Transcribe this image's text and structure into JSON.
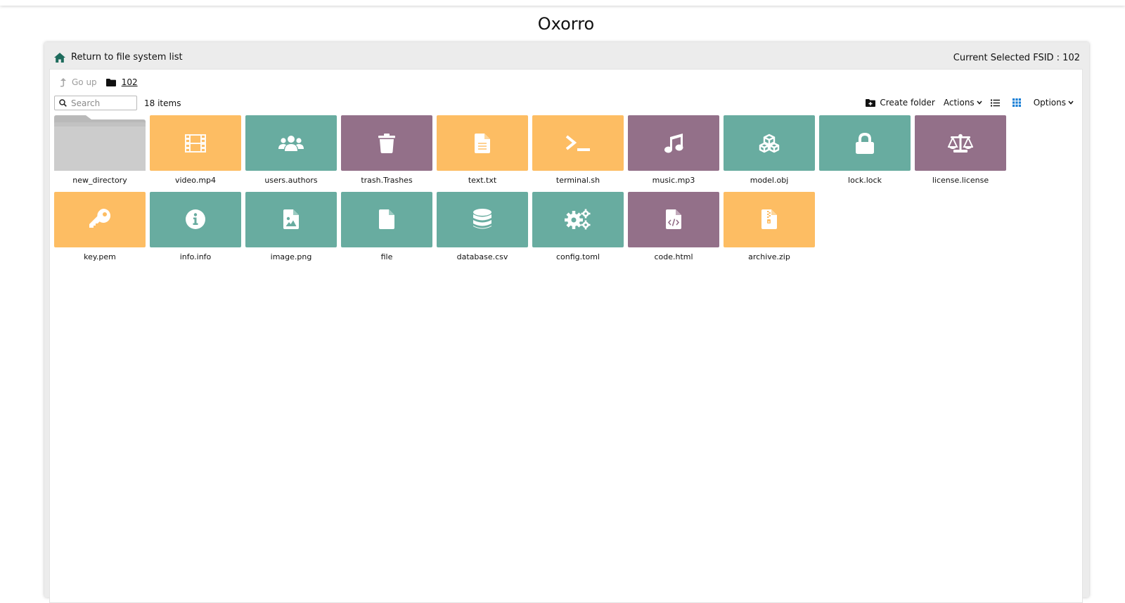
{
  "app": {
    "title": "Oxorro"
  },
  "header": {
    "return_label": "Return to file system list",
    "fsid_label": "Current Selected FSID : 102"
  },
  "breadcrumb": {
    "go_up_label": "Go up",
    "current_folder": "102"
  },
  "search": {
    "placeholder": "Search",
    "value": ""
  },
  "item_count": "18 items",
  "toolbar": {
    "create_folder_label": "Create folder",
    "actions_label": "Actions",
    "options_label": "Options",
    "active_view": "grid"
  },
  "colors": {
    "orange": "#fdbd63",
    "teal": "#68aca0",
    "purple": "#937089",
    "folder": "#cccccc",
    "home_icon": "#1d6b5c",
    "active_view_icon": "#1a7fd6"
  },
  "files": [
    {
      "name": "new_directory",
      "type": "folder",
      "color": "folder",
      "icon": "folder-icon"
    },
    {
      "name": "video.mp4",
      "type": "file",
      "color": "orange",
      "icon": "film-icon"
    },
    {
      "name": "users.authors",
      "type": "file",
      "color": "teal",
      "icon": "users-icon"
    },
    {
      "name": "trash.Trashes",
      "type": "file",
      "color": "purple",
      "icon": "trash-icon"
    },
    {
      "name": "text.txt",
      "type": "file",
      "color": "orange",
      "icon": "text-file-icon"
    },
    {
      "name": "terminal.sh",
      "type": "file",
      "color": "orange",
      "icon": "terminal-icon"
    },
    {
      "name": "music.mp3",
      "type": "file",
      "color": "purple",
      "icon": "music-icon"
    },
    {
      "name": "model.obj",
      "type": "file",
      "color": "teal",
      "icon": "cubes-icon"
    },
    {
      "name": "lock.lock",
      "type": "file",
      "color": "teal",
      "icon": "lock-icon"
    },
    {
      "name": "license.license",
      "type": "file",
      "color": "purple",
      "icon": "scale-icon"
    },
    {
      "name": "key.pem",
      "type": "file",
      "color": "orange",
      "icon": "key-icon"
    },
    {
      "name": "info.info",
      "type": "file",
      "color": "teal",
      "icon": "info-icon"
    },
    {
      "name": "image.png",
      "type": "file",
      "color": "teal",
      "icon": "image-file-icon"
    },
    {
      "name": "file",
      "type": "file",
      "color": "teal",
      "icon": "file-icon"
    },
    {
      "name": "database.csv",
      "type": "file",
      "color": "teal",
      "icon": "database-icon"
    },
    {
      "name": "config.toml",
      "type": "file",
      "color": "teal",
      "icon": "gears-icon"
    },
    {
      "name": "code.html",
      "type": "file",
      "color": "purple",
      "icon": "code-file-icon"
    },
    {
      "name": "archive.zip",
      "type": "file",
      "color": "orange",
      "icon": "zip-file-icon"
    }
  ]
}
